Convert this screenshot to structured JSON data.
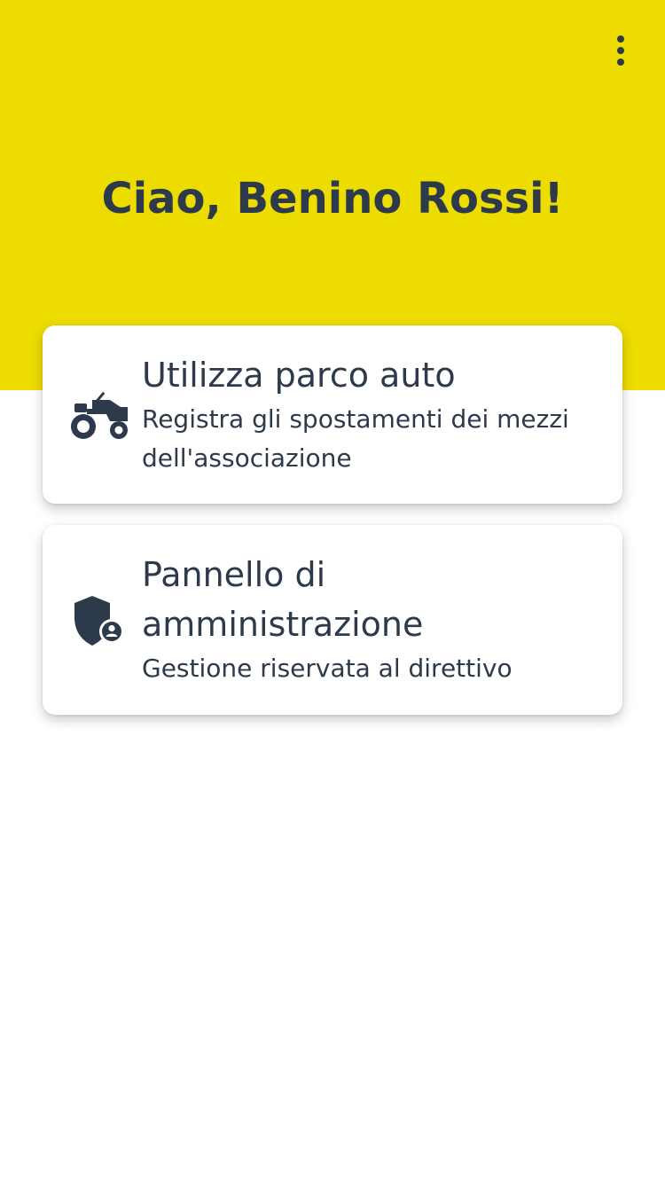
{
  "header": {
    "greeting": "Ciao, Benino Rossi!",
    "menu_icon": "more-vertical-icon",
    "background_color": "#ecdc00"
  },
  "cards": [
    {
      "icon": "tractor-icon",
      "title": "Utilizza parco auto",
      "subtitle_line1": "Registra gli spostamenti dei mezzi",
      "subtitle_line2": "dell'associazione"
    },
    {
      "icon": "shield-user-icon",
      "title_line1": "Pannello di",
      "title_line2": "amministrazione",
      "subtitle": "Gestione riservata al direttivo"
    }
  ],
  "colors": {
    "text": "#2d3a4b",
    "accent": "#ecdc00",
    "card_background": "#ffffff"
  }
}
